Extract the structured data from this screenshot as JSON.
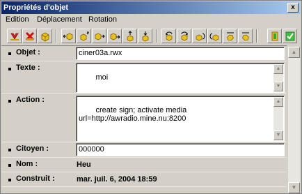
{
  "window": {
    "title": "Propriétés d'objet",
    "close_label": "x"
  },
  "menu": [
    "Edition",
    "Déplacement",
    "Rotation"
  ],
  "toolbar": [
    {
      "name": "load-icon-button",
      "icon": "red-arrow-icon"
    },
    {
      "name": "delete-button",
      "icon": "red-x-icon"
    },
    {
      "name": "duplicate-button",
      "icon": "yellow-box-icon"
    },
    {
      "name": "move-left-button",
      "icon": "box-left-icon"
    },
    {
      "name": "move-up-button",
      "icon": "box-up-icon"
    },
    {
      "name": "move-right-button",
      "icon": "box-right-icon"
    },
    {
      "name": "move-forward-button",
      "icon": "box-forward-icon"
    },
    {
      "name": "move-raise-button",
      "icon": "box-raise-icon"
    },
    {
      "name": "move-lower-button",
      "icon": "box-lower-icon"
    },
    {
      "name": "rotate-left-button",
      "icon": "rotate-left-icon"
    },
    {
      "name": "rotate-right-button",
      "icon": "rotate-right-icon"
    },
    {
      "name": "tilt-forward-button",
      "icon": "tilt-forward-icon"
    },
    {
      "name": "tilt-back-button",
      "icon": "tilt-back-icon"
    },
    {
      "name": "roll-left-button",
      "icon": "roll-left-icon"
    },
    {
      "name": "roll-right-button",
      "icon": "roll-right-icon"
    },
    {
      "name": "lock-button",
      "icon": "green-box-icon"
    },
    {
      "name": "save-button",
      "icon": "green-check-icon"
    }
  ],
  "fields": {
    "objet_label": "Objet :",
    "objet_value": "ciner03a.rwx",
    "texte_label": "Texte :",
    "texte_value": "moi",
    "action_label": "Action :",
    "action_value": "create sign; activate media\nurl=http://awradio.mine.nu:8200",
    "citoyen_label": "Citoyen :",
    "citoyen_value": "000000",
    "nom_label": "Nom :",
    "nom_value": "Heu",
    "construit_label": "Construit :",
    "construit_value": "mar. juil. 6, 2004 18:59"
  }
}
